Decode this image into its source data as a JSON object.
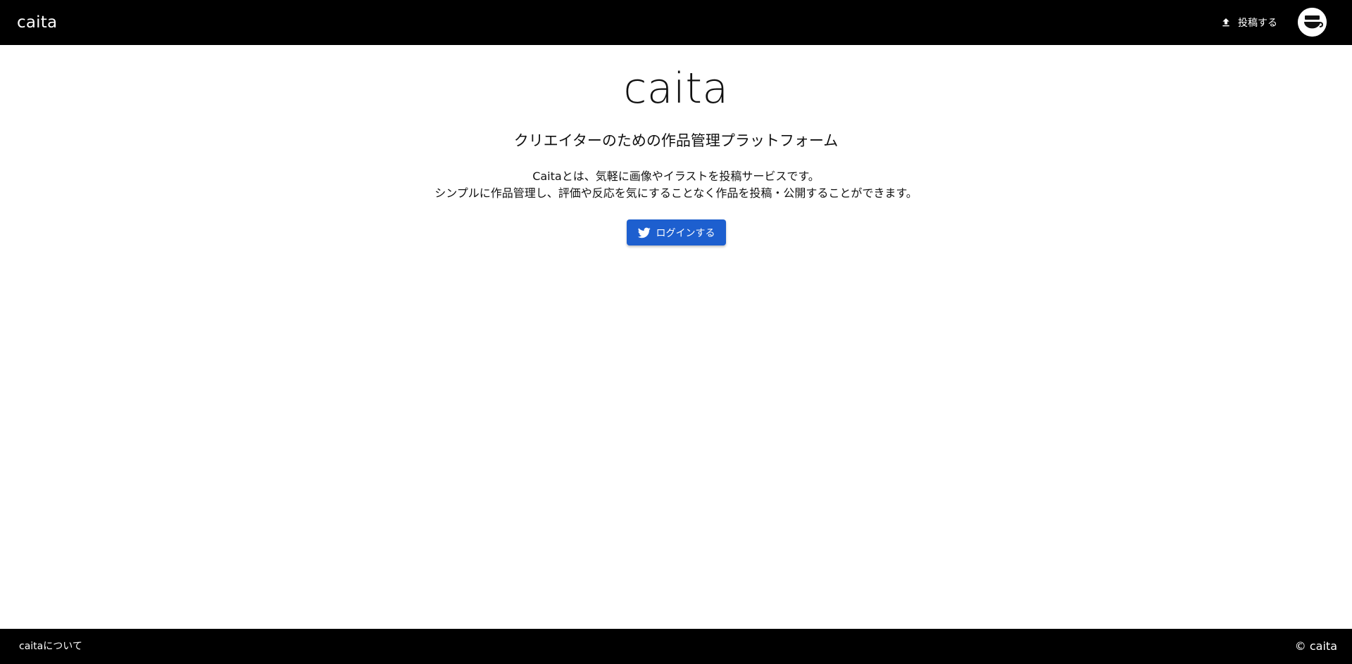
{
  "header": {
    "brand": "caita",
    "post_label": "投稿する",
    "post_icon": "upload-icon",
    "avatar_icon": "user-avatar",
    "background": "#000000"
  },
  "main": {
    "title": "caita",
    "subtitle": "クリエイターのための作品管理プラットフォーム",
    "description_line1": "Caitaとは、気軽に画像やイラストを投稿サービスです。",
    "description_line2": "シンプルに作品管理し、評価や反応を気にすることなく作品を投稿・公開することができます。",
    "login_label": "ログインする",
    "login_icon": "twitter-icon",
    "login_color": "#1d5fcf"
  },
  "footer": {
    "about_label": "caitaについて",
    "copyright": "© caita"
  }
}
